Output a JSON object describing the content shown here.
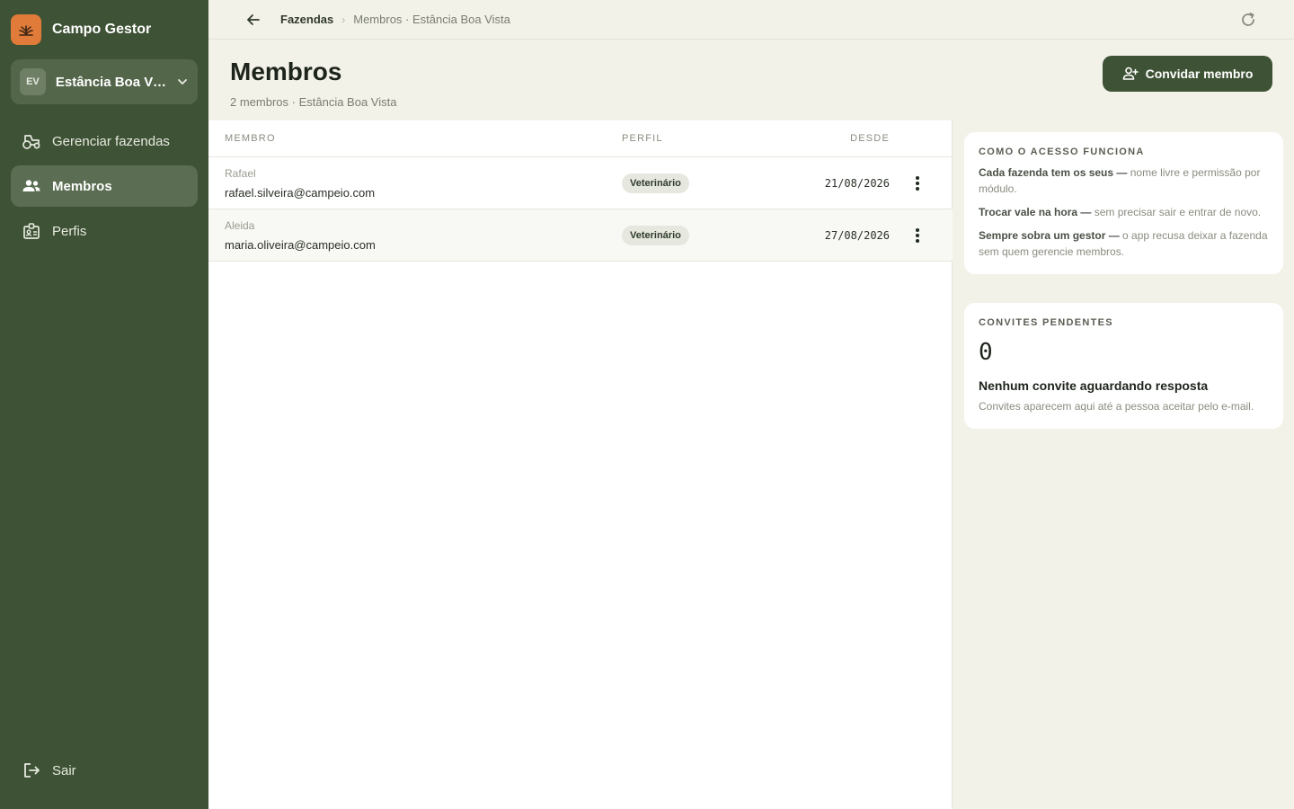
{
  "app": {
    "name": "Campo Gestor"
  },
  "farm": {
    "initials": "EV",
    "name": "Estância Boa Vista"
  },
  "nav": {
    "items": [
      {
        "label": "Gerenciar fazendas",
        "icon": "tractor-icon"
      },
      {
        "label": "Membros",
        "icon": "people-icon",
        "active": true
      },
      {
        "label": "Perfis",
        "icon": "badge-icon"
      }
    ],
    "logout": "Sair"
  },
  "breadcrumb": {
    "root": "Fazendas",
    "current": "Membros · Estância Boa Vista"
  },
  "page": {
    "title": "Membros",
    "subtitle": "2 membros · Estância Boa Vista",
    "invite_label": "Convidar membro"
  },
  "table": {
    "headers": {
      "member": "MEMBRO",
      "role": "PERFIL",
      "since": "DESDE"
    },
    "rows": [
      {
        "name": "Rafael",
        "email": "rafael.silveira@campeio.com",
        "role": "Veterinário",
        "since": "21/08/2026"
      },
      {
        "name": "Aleida",
        "email": "maria.oliveira@campeio.com",
        "role": "Veterinário",
        "since": "27/08/2026"
      }
    ]
  },
  "access_card": {
    "title": "COMO O ACESSO FUNCIONA",
    "items": [
      {
        "strong": "Cada fazenda tem os seus —",
        "text": " nome livre e permissão por módulo."
      },
      {
        "strong": "Trocar vale na hora —",
        "text": " sem precisar sair e entrar de novo."
      },
      {
        "strong": "Sempre sobra um gestor —",
        "text": " o app recusa deixar a fazenda sem quem gerencie membros."
      }
    ]
  },
  "pending_card": {
    "title": "CONVITES PENDENTES",
    "count": "0",
    "empty_title": "Nenhum convite aguardando resposta",
    "empty_desc": "Convites aparecem aqui até a pessoa aceitar pelo e-mail."
  },
  "colors": {
    "sidebar": "#3e5235",
    "brand_accent": "#e07b39",
    "background": "#f3f2e9"
  }
}
